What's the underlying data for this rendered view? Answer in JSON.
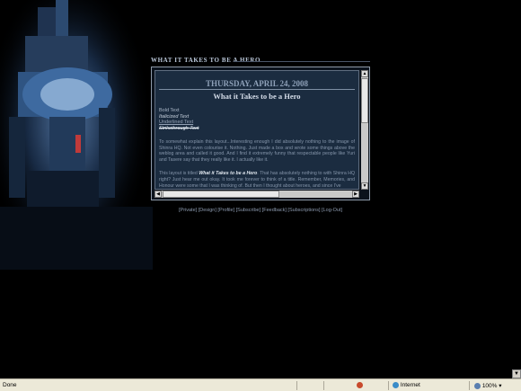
{
  "header": {
    "title": "WHAT IT TAKES TO BE A HERO"
  },
  "post": {
    "date": "THURSDAY, APRIL 24, 2008",
    "title": "What it Takes to be a Hero",
    "format_samples": [
      "Bold Text",
      "Italicized Text",
      "Underlined Text",
      "Strikethrough Text"
    ],
    "paragraph1": "To somewhat explain this layout...Interesting enough I did absolutely nothing to the image of Shinra HQ. Not even colourise it. Nothing. Just made a box and wrote some things above the weblog area and called it good. And I find it extremely funny that respectable people like Yuri and Tasere say that they really like it. I actually like it.",
    "paragraph2_prefix": "This layout is titled ",
    "paragraph2_em": "What it Takes to be a Hero",
    "paragraph2_rest": ". That has absolutely nothing to with Shinra HQ right? Just hear me out okay. It took me forever to think of a title. Remember, Memories, and Honour were some that I was thinking of. But then I thought about heroes, and since I've"
  },
  "nav": {
    "links": [
      "Private",
      "Design",
      "Profile",
      "Subscribe",
      "Feedback",
      "Subscriptions",
      "Log-Out"
    ]
  },
  "statusbar": {
    "status_text": "Done",
    "zone_text": "Internet",
    "zoom_text": "100%"
  },
  "icons": {
    "scroll_up": "up-arrow-icon",
    "scroll_down": "down-arrow-icon",
    "scroll_left": "left-arrow-icon",
    "scroll_right": "right-arrow-icon",
    "internet": "globe-icon",
    "zoom": "magnifier-icon"
  }
}
